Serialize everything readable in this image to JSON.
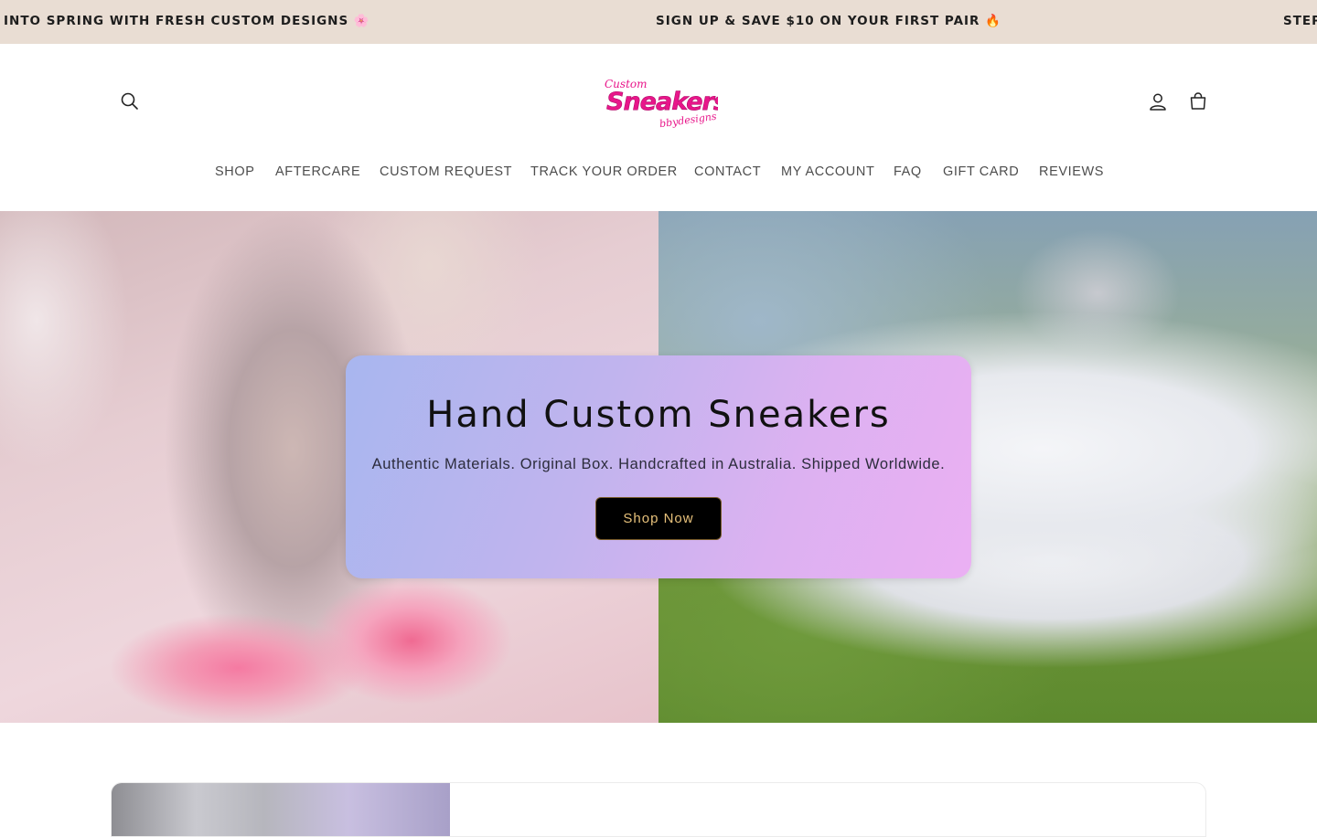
{
  "announcement": {
    "messages": [
      "INTO SPRING WITH FRESH CUSTOM DESIGNS 🌸",
      "SIGN UP & SAVE $10 ON YOUR FIRST PAIR 🔥",
      "STEP"
    ]
  },
  "header": {
    "logo": {
      "line1": "Custom",
      "line2": "Sneakers",
      "line3": "bbydesigns"
    },
    "icons": [
      "search-icon",
      "account-icon",
      "cart-icon"
    ]
  },
  "nav": {
    "items": [
      {
        "label": "SHOP"
      },
      {
        "label": "AFTERCARE"
      },
      {
        "label": "CUSTOM REQUEST"
      },
      {
        "label": "TRACK YOUR ORDER"
      },
      {
        "label": "CONTACT"
      },
      {
        "label": "MY ACCOUNT"
      },
      {
        "label": "FAQ"
      },
      {
        "label": "GIFT CARD"
      },
      {
        "label": "REVIEWS"
      }
    ]
  },
  "hero": {
    "title": "Hand Custom Sneakers",
    "subtitle": "Authentic Materials. Original Box. Handcrafted in Australia. Shipped Worldwide.",
    "button_label": "Shop Now"
  },
  "colors": {
    "announcement_bg": "#e9ddd3",
    "brand_pink": "#e8168a",
    "hero_card_start": "#a8b6ef",
    "hero_card_end": "#ebb0f3",
    "button_bg": "#000000",
    "button_text": "#e6c07a"
  }
}
